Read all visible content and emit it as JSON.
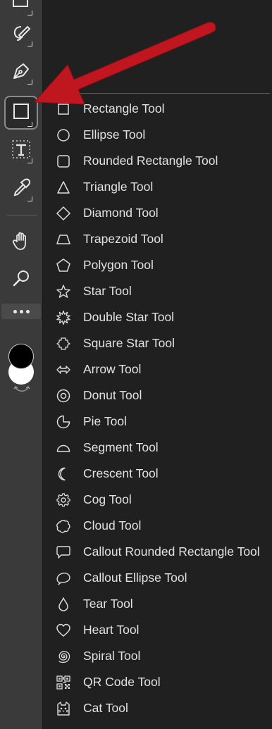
{
  "toolbar": {
    "tools": [
      {
        "icon": "selection-icon"
      },
      {
        "icon": "lasso-brush-icon"
      },
      {
        "icon": "pen-tool-icon"
      },
      {
        "icon": "rectangle-tool-icon",
        "active": true
      },
      {
        "icon": "text-tool-icon"
      },
      {
        "icon": "eyedropper-icon"
      },
      {
        "icon": "hand-tool-icon"
      },
      {
        "icon": "zoom-tool-icon"
      }
    ],
    "more_icon": "more-dots-icon",
    "foreground_color": "#000000",
    "background_color": "#ffffff"
  },
  "annotation": {
    "arrow_color": "#c0161f"
  },
  "flyout": {
    "items": [
      {
        "label": "Rectangle Tool",
        "icon": "rectangle-icon"
      },
      {
        "label": "Ellipse Tool",
        "icon": "ellipse-icon"
      },
      {
        "label": "Rounded Rectangle Tool",
        "icon": "rounded-rectangle-icon"
      },
      {
        "label": "Triangle Tool",
        "icon": "triangle-icon"
      },
      {
        "label": "Diamond Tool",
        "icon": "diamond-icon"
      },
      {
        "label": "Trapezoid Tool",
        "icon": "trapezoid-icon"
      },
      {
        "label": "Polygon Tool",
        "icon": "polygon-icon"
      },
      {
        "label": "Star Tool",
        "icon": "star-icon"
      },
      {
        "label": "Double Star Tool",
        "icon": "double-star-icon"
      },
      {
        "label": "Square Star Tool",
        "icon": "square-star-icon"
      },
      {
        "label": "Arrow Tool",
        "icon": "arrow-icon"
      },
      {
        "label": "Donut Tool",
        "icon": "donut-icon"
      },
      {
        "label": "Pie Tool",
        "icon": "pie-icon"
      },
      {
        "label": "Segment Tool",
        "icon": "segment-icon"
      },
      {
        "label": "Crescent Tool",
        "icon": "crescent-icon"
      },
      {
        "label": "Cog Tool",
        "icon": "cog-icon"
      },
      {
        "label": "Cloud Tool",
        "icon": "cloud-icon"
      },
      {
        "label": "Callout Rounded Rectangle Tool",
        "icon": "callout-rounded-rectangle-icon"
      },
      {
        "label": "Callout Ellipse Tool",
        "icon": "callout-ellipse-icon"
      },
      {
        "label": "Tear Tool",
        "icon": "tear-icon"
      },
      {
        "label": "Heart Tool",
        "icon": "heart-icon"
      },
      {
        "label": "Spiral Tool",
        "icon": "spiral-icon"
      },
      {
        "label": "QR Code Tool",
        "icon": "qr-code-icon"
      },
      {
        "label": "Cat Tool",
        "icon": "cat-icon"
      }
    ]
  }
}
